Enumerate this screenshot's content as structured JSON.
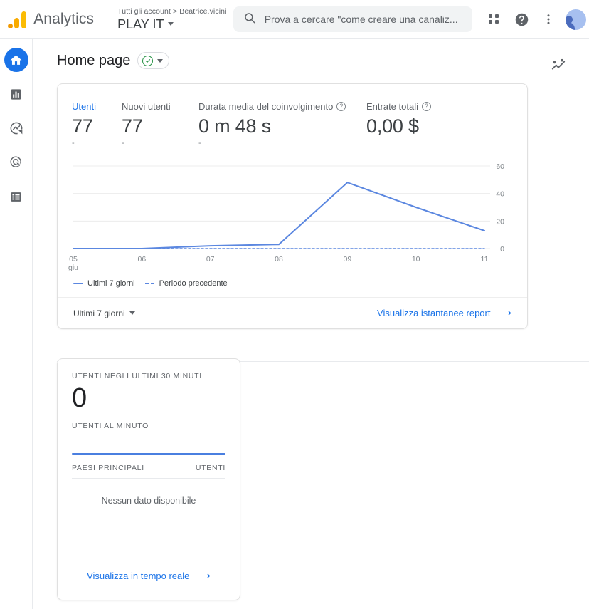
{
  "header": {
    "brand": "Analytics",
    "logo_icon": "google-analytics-logo",
    "account_breadcrumb": "Tutti gli account > Beatrice.vicini",
    "property_name": "PLAY IT",
    "search_placeholder": "Prova a cercare \"come creare una canaliz...",
    "search_value": "",
    "icons": {
      "search": "search-icon",
      "apps": "apps-grid-icon",
      "help": "help-circle-icon",
      "more": "more-vert-icon",
      "avatar": "user-avatar"
    }
  },
  "sidebar": {
    "items": [
      {
        "name": "home",
        "icon": "home-icon",
        "active": true
      },
      {
        "name": "reports",
        "icon": "bar-chart-icon",
        "active": false
      },
      {
        "name": "explore",
        "icon": "explore-compass-icon",
        "active": false
      },
      {
        "name": "advertising",
        "icon": "advertising-target-icon",
        "active": false
      },
      {
        "name": "library",
        "icon": "library-list-icon",
        "active": false
      }
    ]
  },
  "page": {
    "title": "Home page",
    "status_icon": "check-circle-green-icon",
    "status_dropdown_icon": "chevron-down-icon",
    "insights_icon": "insights-sparkline-icon"
  },
  "overview_card": {
    "metrics": [
      {
        "label": "Utenti",
        "value": "77",
        "sub": "-",
        "selected": true,
        "has_help": false
      },
      {
        "label": "Nuovi utenti",
        "value": "77",
        "sub": "-",
        "selected": false,
        "has_help": false
      },
      {
        "label": "Durata media del coinvolgimento",
        "value": "0 m 48 s",
        "sub": "-",
        "selected": false,
        "has_help": true
      },
      {
        "label": "Entrate totali",
        "value": "0,00 $",
        "sub": "",
        "selected": false,
        "has_help": true
      }
    ],
    "legend": [
      {
        "label": "Ultimi 7 giorni",
        "style": "solid"
      },
      {
        "label": "Periodo precedente",
        "style": "dashed"
      }
    ],
    "footer": {
      "date_range": "Ultimi 7 giorni",
      "date_range_icon": "chevron-down-icon",
      "link": "Visualizza istantanee report",
      "link_icon": "arrow-right-icon"
    }
  },
  "chart_data": {
    "type": "line",
    "title": "",
    "xlabel": "giu",
    "ylabel": "",
    "categories": [
      "05",
      "06",
      "07",
      "08",
      "09",
      "10",
      "11"
    ],
    "x_axis_note": "giu",
    "ylim": [
      0,
      60
    ],
    "yticks": [
      0,
      20,
      40,
      60
    ],
    "grid": true,
    "legend_position": "bottom-left",
    "series": [
      {
        "name": "Ultimi 7 giorni",
        "style": "solid",
        "color": "#5b87e0",
        "values": [
          0,
          0,
          2,
          3,
          48,
          30,
          13
        ]
      },
      {
        "name": "Periodo precedente",
        "style": "dashed",
        "color": "#5b87e0",
        "values": [
          0,
          0,
          0,
          0,
          0,
          0,
          0
        ]
      }
    ]
  },
  "realtime_card": {
    "users_label": "UTENTI NEGLI ULTIMI 30 MINUTI",
    "users_value": "0",
    "per_minute_label": "UTENTI AL MINUTO",
    "table": {
      "headers": [
        "PAESI PRINCIPALI",
        "UTENTI"
      ],
      "rows": [],
      "empty_text": "Nessun dato disponibile"
    },
    "footer": {
      "link": "Visualizza in tempo reale",
      "link_icon": "arrow-right-icon"
    }
  },
  "colors": {
    "accent_blue": "#1a73e8",
    "chart_blue": "#5b87e0",
    "green": "#1e8e3e",
    "logo_orange": "#f29900",
    "logo_yellow": "#fbbc04"
  }
}
